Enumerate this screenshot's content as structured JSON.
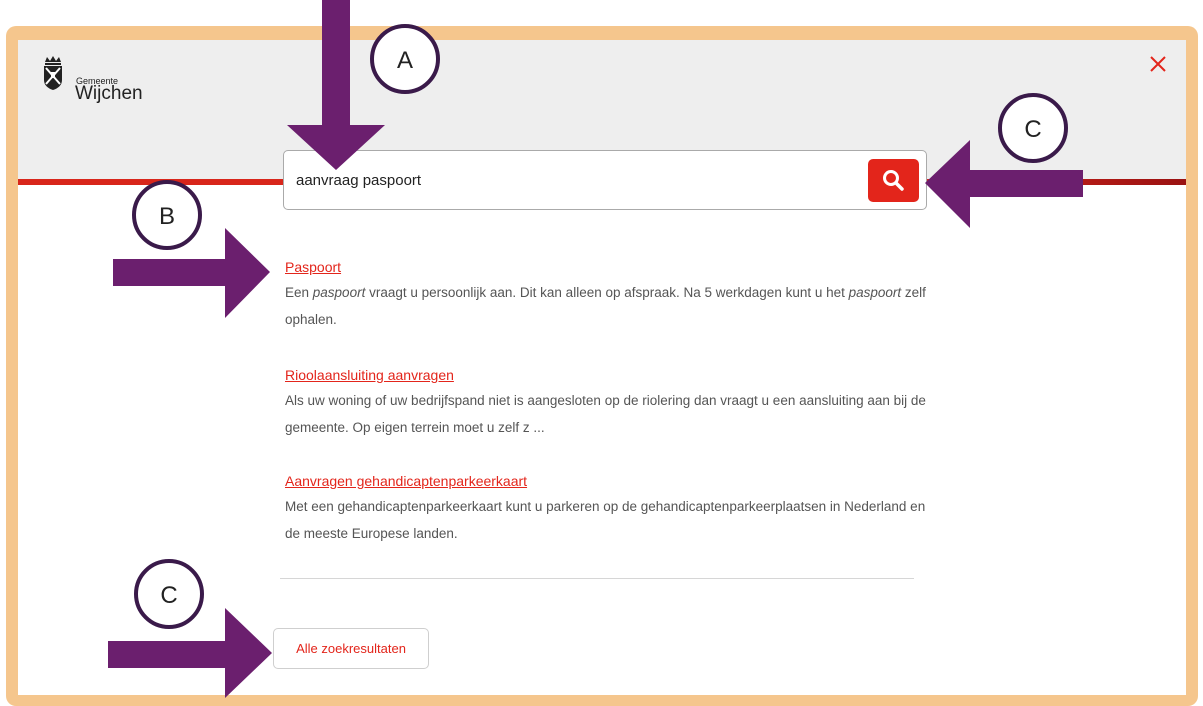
{
  "header": {
    "logo_small": "Gemeente",
    "logo_big": "Wijchen"
  },
  "search": {
    "value": "aanvraag paspoort"
  },
  "results": [
    {
      "title": "Paspoort",
      "snippet_parts": [
        {
          "text": "Een ",
          "em": false
        },
        {
          "text": "paspoort",
          "em": true
        },
        {
          "text": " vraagt u persoonlijk aan. Dit kan alleen op afspraak. Na 5 werkdagen kunt u het ",
          "em": false
        },
        {
          "text": "paspoort",
          "em": true
        },
        {
          "text": " zelf ophalen.",
          "em": false
        }
      ]
    },
    {
      "title": "Rioolaansluiting aanvragen",
      "snippet_parts": [
        {
          "text": "Als uw woning of uw bedrijfspand niet is aangesloten op de riolering dan vraagt u een aansluiting aan bij de gemeente. Op eigen terrein moet u zelf z ...",
          "em": false
        }
      ]
    },
    {
      "title": "Aanvragen gehandicaptenparkeerkaart",
      "snippet_parts": [
        {
          "text": "Met een gehandicaptenparkeerkaart kunt u parkeren op de gehandicaptenparkeerplaatsen in Nederland en de meeste Europese landen.",
          "em": false
        }
      ]
    }
  ],
  "all_results_label": "Alle zoekresultaten",
  "annotations": {
    "a": "A",
    "b": "B",
    "c_top": "C",
    "c_bottom": "C"
  },
  "colors": {
    "accent_red": "#e3251b",
    "frame_orange": "#f5c68d",
    "arrow_purple": "#6b1f6e"
  }
}
